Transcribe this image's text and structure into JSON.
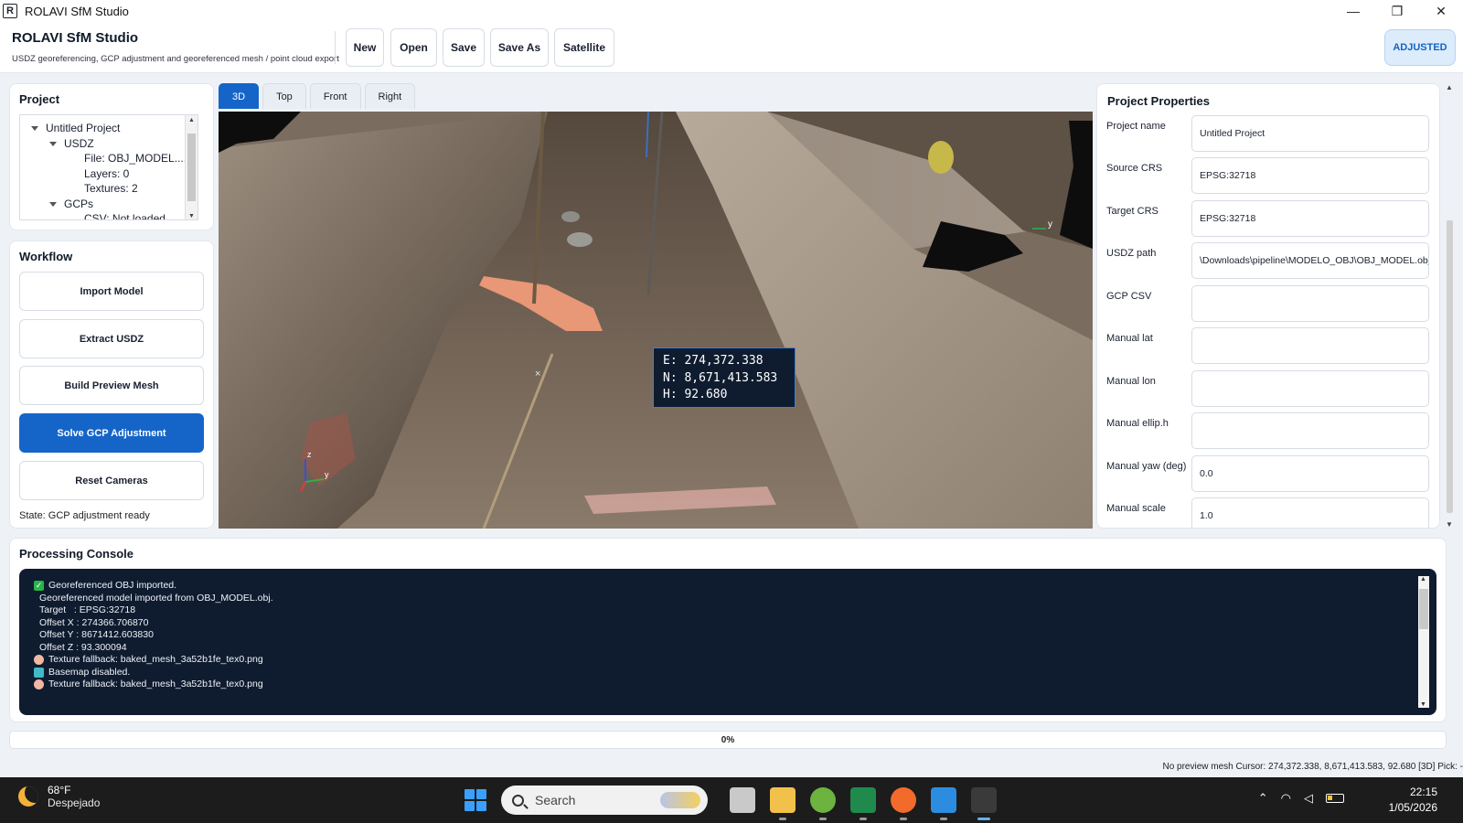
{
  "window": {
    "title": "ROLAVI SfM Studio",
    "minimize": "—",
    "maximize": "❐",
    "close": "✕"
  },
  "header": {
    "title": "ROLAVI SfM Studio",
    "subtitle": "USDZ georeferencing, GCP adjustment and georeferenced mesh / point cloud export",
    "toolbar": [
      "New",
      "Open",
      "Save",
      "Save As",
      "Satellite"
    ],
    "status": "ADJUSTED"
  },
  "project": {
    "title": "Project",
    "tree": [
      {
        "label": "Untitled Project",
        "level": 0,
        "expanded": true
      },
      {
        "label": "USDZ",
        "level": 1,
        "expanded": true
      },
      {
        "label": "File: OBJ_MODEL....",
        "level": 2
      },
      {
        "label": "Layers: 0",
        "level": 2
      },
      {
        "label": "Textures: 2",
        "level": 2
      },
      {
        "label": "GCPs",
        "level": 1,
        "expanded": true
      },
      {
        "label": "CSV: Not loaded",
        "level": 2
      }
    ]
  },
  "workflow": {
    "title": "Workflow",
    "buttons": [
      {
        "label": "Import Model",
        "primary": false
      },
      {
        "label": "Extract USDZ",
        "primary": false
      },
      {
        "label": "Build Preview Mesh",
        "primary": false
      },
      {
        "label": "Solve GCP Adjustment",
        "primary": true
      },
      {
        "label": "Reset Cameras",
        "primary": false
      }
    ],
    "state": "State: GCP adjustment ready"
  },
  "viewport": {
    "tabs": [
      "3D",
      "Top",
      "Front",
      "Right"
    ],
    "active_tab": "3D",
    "pick": {
      "e": "E: 274,372.338",
      "n": "N: 8,671,413.583",
      "h": "H: 92.680"
    },
    "axis_labels": {
      "y": "y",
      "z": "z",
      "x": "x"
    }
  },
  "properties": {
    "title": "Project Properties",
    "fields": [
      {
        "label": "Project name",
        "value": "Untitled Project"
      },
      {
        "label": "Source CRS",
        "value": "EPSG:32718"
      },
      {
        "label": "Target CRS",
        "value": "EPSG:32718"
      },
      {
        "label": "USDZ path",
        "value": "\\Downloads\\pipeline\\MODELO_OBJ\\OBJ_MODEL.obj"
      },
      {
        "label": "GCP CSV",
        "value": ""
      },
      {
        "label": "Manual lat",
        "value": ""
      },
      {
        "label": "Manual lon",
        "value": ""
      },
      {
        "label": "Manual ellip.h",
        "value": ""
      },
      {
        "label": "Manual yaw (deg)",
        "value": "0.0"
      },
      {
        "label": "Manual scale",
        "value": "1.0"
      }
    ]
  },
  "console": {
    "title": "Processing Console",
    "lines": [
      {
        "icon": "check-icon",
        "text": "Georeferenced OBJ imported."
      },
      {
        "icon": "",
        "text": "Georeferenced model imported from OBJ_MODEL.obj."
      },
      {
        "icon": "",
        "text": "Target   : EPSG:32718"
      },
      {
        "icon": "",
        "text": "Offset X : 274366.706870"
      },
      {
        "icon": "",
        "text": "Offset Y : 8671412.603830"
      },
      {
        "icon": "",
        "text": "Offset Z : 93.300094"
      },
      {
        "icon": "palette-icon",
        "text": "Texture fallback: baked_mesh_3a52b1fe_tex0.png"
      },
      {
        "icon": "map-icon",
        "text": "Basemap disabled."
      },
      {
        "icon": "palette-icon",
        "text": "Texture fallback: baked_mesh_3a52b1fe_tex0.png"
      }
    ]
  },
  "progress": {
    "value": 0,
    "text": "0%"
  },
  "statusbar": "No preview mesh  Cursor: 274,372.338, 8,671,413.583, 92.680  [3D]  Pick: -",
  "taskbar": {
    "temp": "68°F",
    "weather": "Despejado",
    "search_placeholder": "Search",
    "time": "22:15",
    "date": "1/05/2026",
    "apps": [
      "task-view-icon",
      "file-explorer-icon",
      "qgis-icon",
      "excel-icon",
      "firefox-icon",
      "vscode-icon",
      "python-icon"
    ]
  },
  "colors": {
    "accent": "#1565c8",
    "console_bg": "#0f1c30",
    "status_pill_bg": "#dcecfb"
  }
}
